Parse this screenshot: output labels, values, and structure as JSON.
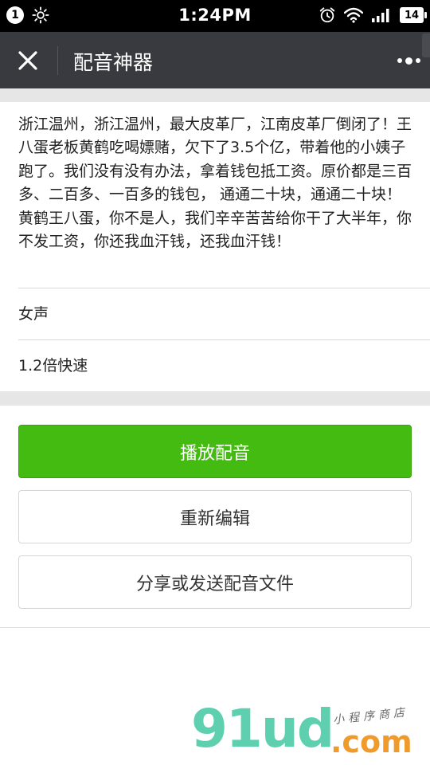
{
  "status_bar": {
    "notification_count": "1",
    "time": "1:24PM",
    "battery": "14"
  },
  "titlebar": {
    "title": "配音神器"
  },
  "content": {
    "script_text": "浙江温州，浙江温州，最大皮革厂，江南皮革厂倒闭了！王八蛋老板黄鹤吃喝嫖赌，欠下了3.5个亿，带着他的小姨子跑了。我们没有没有办法，拿着钱包抵工资。原价都是三百多、二百多、一百多的钱包， 通通二十块，通通二十块！黄鹤王八蛋，你不是人，我们辛辛苦苦给你干了大半年，你不发工资，你还我血汗钱，还我血汗钱！",
    "voice": "女声",
    "speed": "1.2倍快速"
  },
  "buttons": {
    "play": "播放配音",
    "re_edit": "重新编辑",
    "share": "分享或发送配音文件"
  },
  "watermark": {
    "main": "91ud",
    "domain": ".com",
    "tagline": "小程序商店"
  },
  "colors": {
    "statusbar_bg": "#000000",
    "titlebar_bg": "#393a3f",
    "primary_green": "#44bb11",
    "band_gray": "#e6e6e6"
  }
}
